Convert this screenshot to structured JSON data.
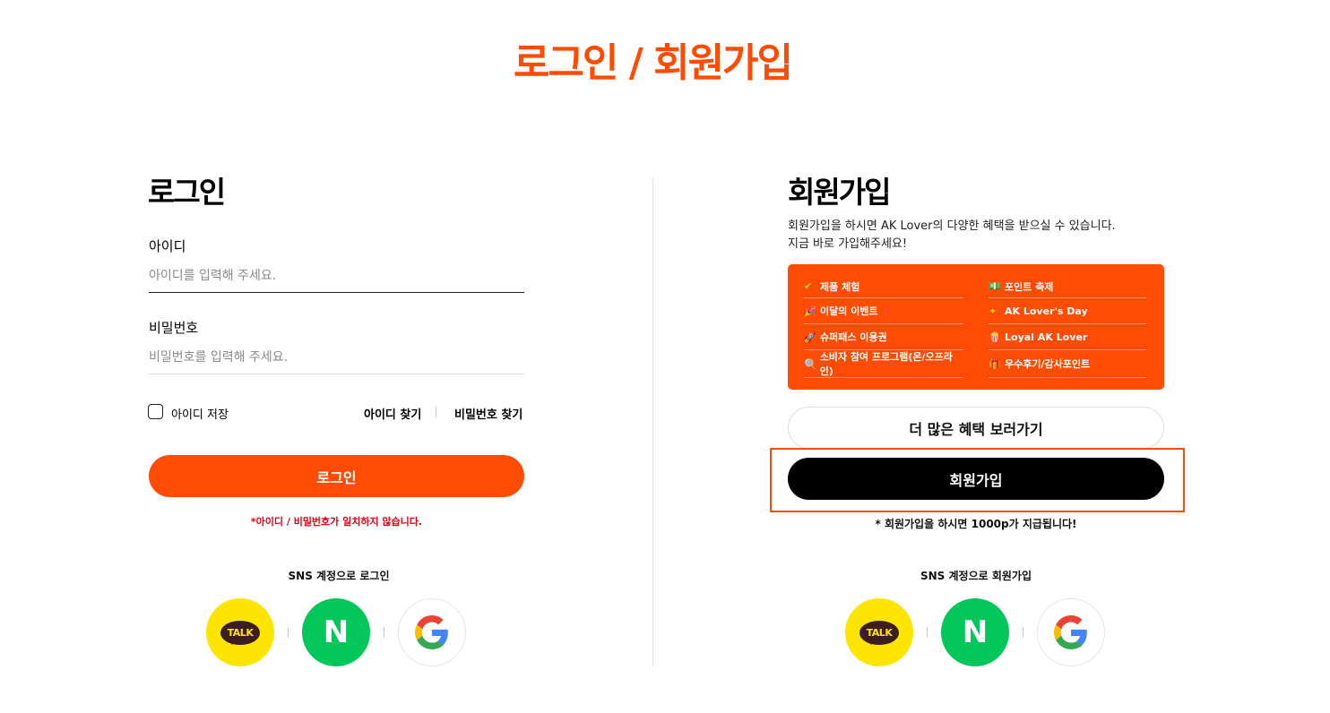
{
  "page": {
    "title": "로그인 / 회원가입"
  },
  "login": {
    "title": "로그인",
    "id_label": "아이디",
    "id_placeholder": "아이디를 입력해 주세요.",
    "pw_label": "비밀번호",
    "pw_placeholder": "비밀번호를 입력해 주세요.",
    "remember_label": "아이디 저장",
    "find_id": "아이디 찾기",
    "find_pw": "비밀번호 찾기",
    "button": "로그인",
    "error": "*아이디 / 비밀번호가 일치하지 않습니다.",
    "sns_title": "SNS 계정으로 로그인"
  },
  "signup": {
    "title": "회원가입",
    "desc_line1": "회원가입을 하시면 AK Lover의 다양한 혜택을 받으실 수 있습니다.",
    "desc_line2": "지금 바로 가입해주세요!",
    "benefits": [
      {
        "icon": "✔",
        "label": "제품 체험"
      },
      {
        "icon": "💵",
        "label": "포인트 축제"
      },
      {
        "icon": "🎉",
        "label": "이달의 이벤트"
      },
      {
        "icon": "✦",
        "label": "AK Lover's Day"
      },
      {
        "icon": "🚀",
        "label": "슈퍼패스 이용권"
      },
      {
        "icon": "🍿",
        "label": "Loyal AK Lover"
      },
      {
        "icon": "🍭",
        "label": "소비자 참여 프로그램(온/오프라인)"
      },
      {
        "icon": "🎁",
        "label": "우수후기/감사포인트"
      }
    ],
    "more_button": "더 많은 혜택 보러가기",
    "join_button": "회원가입",
    "note": "* 회원가입을 하시면 1000p가 지급됩니다!",
    "sns_title": "SNS 계정으로 회원가입"
  },
  "sns": {
    "kakao_text": "TALK",
    "naver_text": "N"
  },
  "colors": {
    "accent": "#ff4c05",
    "kakao": "#fee500",
    "naver": "#03c75a"
  }
}
